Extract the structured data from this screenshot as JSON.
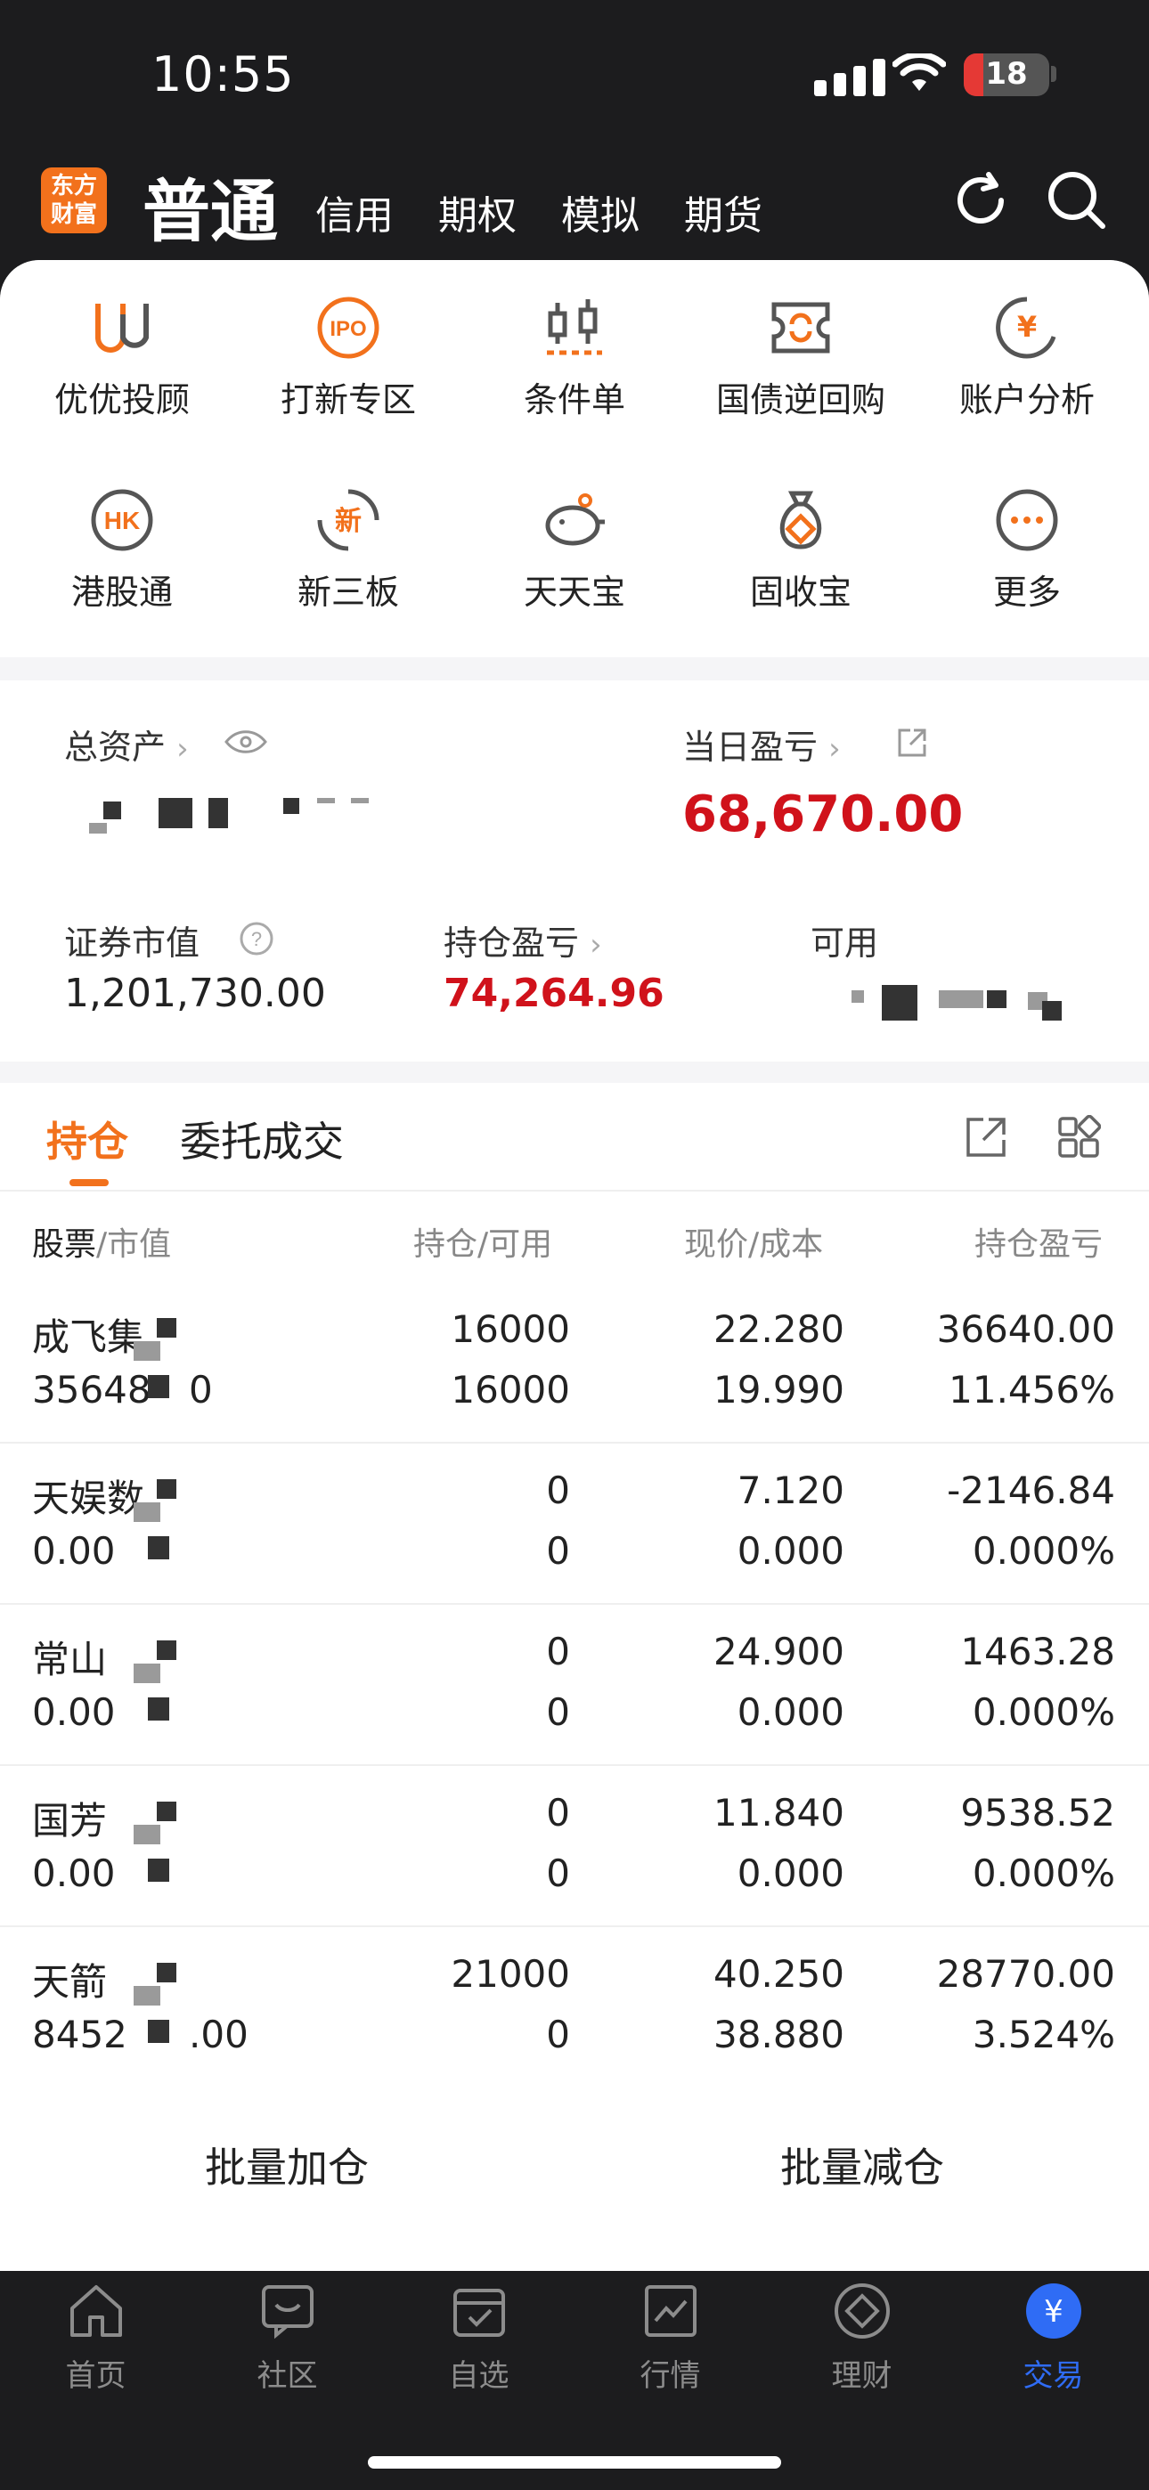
{
  "status": {
    "time": "10:55",
    "battery": "18"
  },
  "nav": {
    "logo": "东方\n财富",
    "main": "普通",
    "tabs": [
      "信用",
      "期权",
      "模拟",
      "期货"
    ]
  },
  "grid": [
    {
      "label": "优优投顾",
      "icon": "uu-advisor-icon"
    },
    {
      "label": "打新专区",
      "icon": "ipo-icon"
    },
    {
      "label": "条件单",
      "icon": "condition-order-icon"
    },
    {
      "label": "国债逆回购",
      "icon": "reverse-repo-icon"
    },
    {
      "label": "账户分析",
      "icon": "account-analysis-icon"
    },
    {
      "label": "港股通",
      "icon": "hk-connect-icon"
    },
    {
      "label": "新三板",
      "icon": "new-third-board-icon"
    },
    {
      "label": "天天宝",
      "icon": "piggy-bank-icon"
    },
    {
      "label": "固收宝",
      "icon": "fixed-income-bag-icon"
    },
    {
      "label": "更多",
      "icon": "more-icon"
    }
  ],
  "assets": {
    "total_label": "总资产",
    "daily_pl_label": "当日盈亏",
    "daily_pl_value": "68,670.00",
    "market_value_label": "证券市值",
    "market_value": "1,201,730.00",
    "position_pl_label": "持仓盈亏",
    "position_pl_value": "74,264.96",
    "available_label": "可用"
  },
  "tabs": {
    "holdings": "持仓",
    "orders": "委托成交"
  },
  "table": {
    "headers": {
      "c1a": "股票",
      "c1b": "市值",
      "c2a": "持仓",
      "c2b": "可用",
      "c3a": "现价",
      "c3b": "成本",
      "c4": "持仓盈亏"
    },
    "rows": [
      {
        "name": "成飞集",
        "mv": "35648",
        "mv_tail": "0",
        "pos": "16000",
        "avail": "16000",
        "price": "22.280",
        "cost": "19.990",
        "pl": "36640.00",
        "plpct": "11.456%",
        "color": "red"
      },
      {
        "name": "天娱数",
        "mv": "0.00",
        "mv_tail": "",
        "pos": "0",
        "avail": "0",
        "price": "7.120",
        "cost": "0.000",
        "pl": "-2146.84",
        "plpct": "0.000%",
        "color": "green"
      },
      {
        "name": "常山",
        "mv": "0.00",
        "mv_tail": "",
        "pos": "0",
        "avail": "0",
        "price": "24.900",
        "cost": "0.000",
        "pl": "1463.28",
        "plpct": "0.000%",
        "color": "red"
      },
      {
        "name": "国芳",
        "mv": "0.00",
        "mv_tail": "",
        "pos": "0",
        "avail": "0",
        "price": "11.840",
        "cost": "0.000",
        "pl": "9538.52",
        "plpct": "0.000%",
        "color": "red"
      },
      {
        "name": "天箭",
        "mv": "8452",
        "mv_tail": ".00",
        "pos": "21000",
        "avail": "0",
        "price": "40.250",
        "cost": "38.880",
        "pl": "28770.00",
        "plpct": "3.524%",
        "color": "red"
      }
    ]
  },
  "batch": {
    "add": "批量加仓",
    "reduce": "批量减仓"
  },
  "tabbar": [
    {
      "label": "首页",
      "icon": "home-icon"
    },
    {
      "label": "社区",
      "icon": "community-icon"
    },
    {
      "label": "自选",
      "icon": "watchlist-icon"
    },
    {
      "label": "行情",
      "icon": "market-icon"
    },
    {
      "label": "理财",
      "icon": "wealth-icon"
    },
    {
      "label": "交易",
      "icon": "trade-icon"
    }
  ],
  "colors": {
    "accent": "#f2711c",
    "up": "#d0121b",
    "down": "#3a9b29",
    "tab_active": "#2f6cf5"
  }
}
